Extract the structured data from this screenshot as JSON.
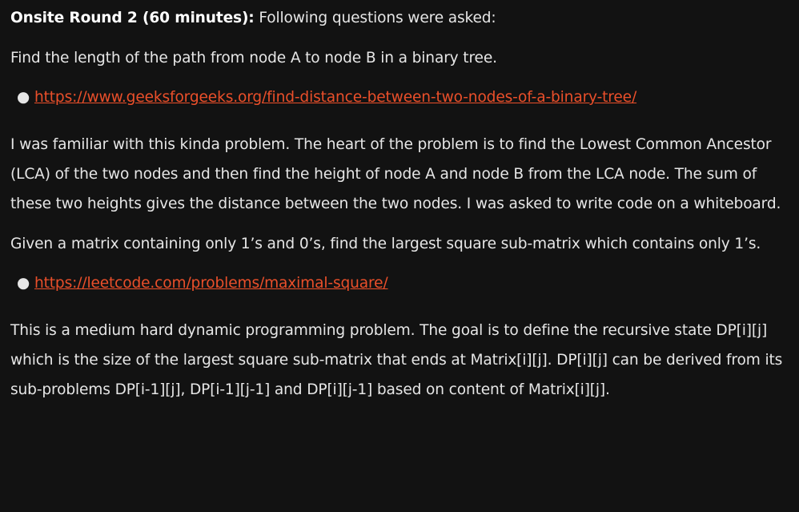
{
  "heading": {
    "bold": "Onsite Round 2 (60 minutes):",
    "rest": " Following questions were asked:"
  },
  "q1": {
    "text": "Find the length of the path from node A to node B in a binary tree.",
    "link": "https://www.geeksforgeeks.org/find-distance-between-two-nodes-of-a-binary-tree/"
  },
  "q1_explanation": "I was familiar with this kinda problem. The heart of the problem is to find the Lowest Common Ancestor (LCA) of the two nodes and then find the height of node A and node B from the LCA node. The sum of these two heights gives the distance between the two nodes. I was asked to write code on a whiteboard.",
  "q2": {
    "text": "Given a matrix containing only 1’s and 0’s, find the largest square sub-matrix which contains only 1’s.",
    "link": "https://leetcode.com/problems/maximal-square/"
  },
  "q2_explanation": "This is a medium hard dynamic programming problem. The goal is to define the recursive state DP[i][j] which is the size of the largest square sub-matrix that ends at Matrix[i][j]. DP[i][j] can be derived from its sub-problems DP[i-1][j], DP[i-1][j-1] and DP[i][j-1] based on content of Matrix[i][j]."
}
